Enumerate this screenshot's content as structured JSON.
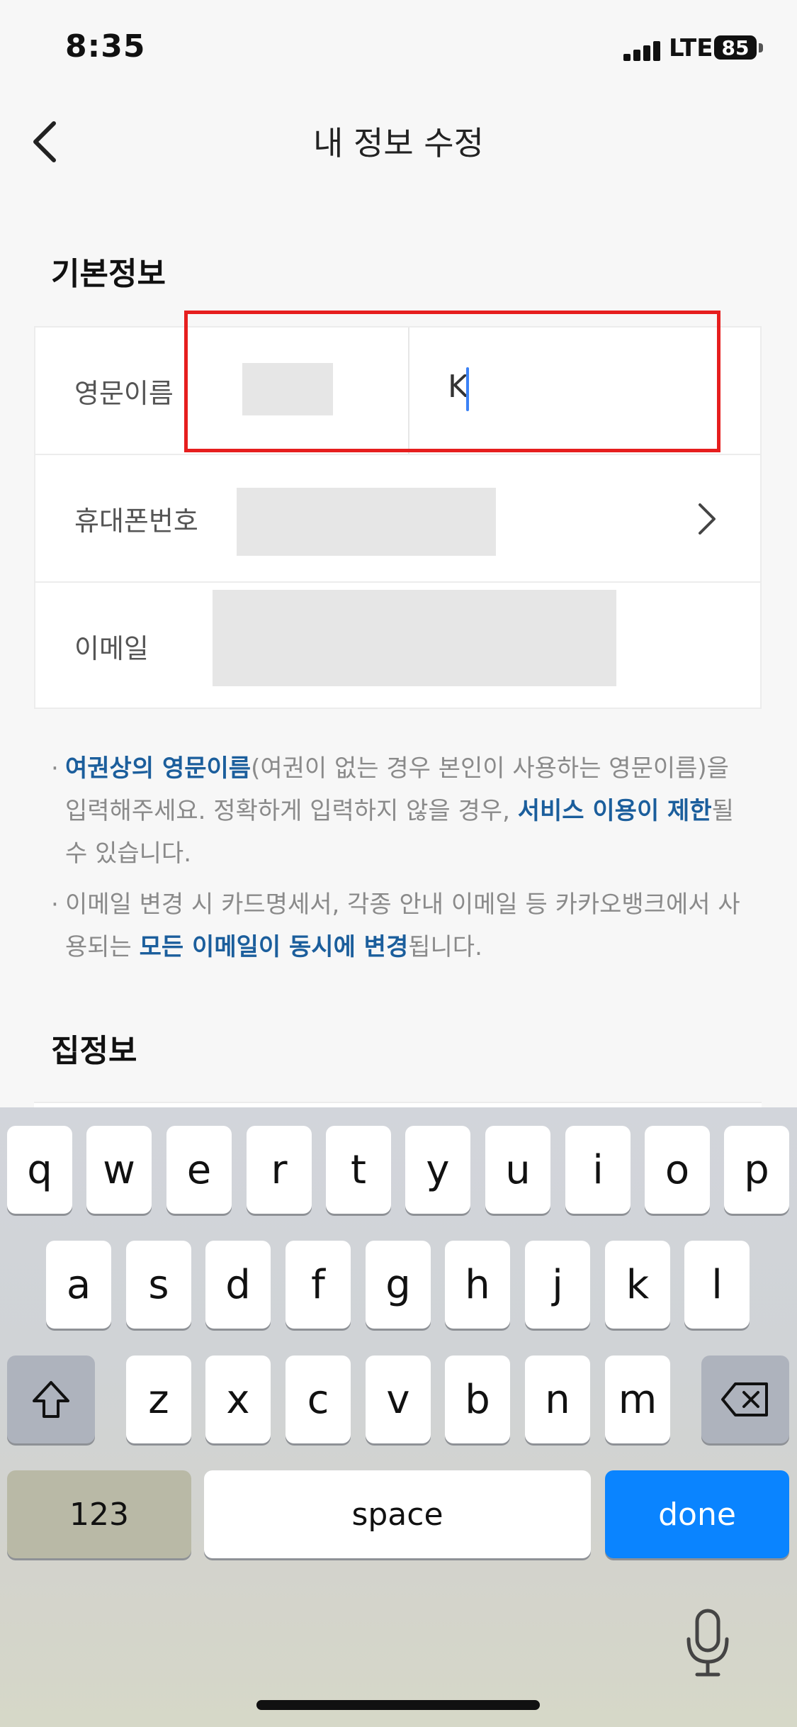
{
  "status": {
    "time": "8:35",
    "network": "LTE",
    "battery": "85"
  },
  "header": {
    "title": "내 정보 수정"
  },
  "basic": {
    "title": "기본정보",
    "rows": [
      {
        "label": "영문이름",
        "value": "K"
      },
      {
        "label": "휴대폰번호"
      },
      {
        "label": "이메일"
      }
    ]
  },
  "notes": [
    {
      "pre": "",
      "hl1": "여권상의 영문이름",
      "mid": "(여권이 없는 경우 본인이 사용하는 영문이름)을 입력해주세요. 정확하게 입력하지 않을 경우, ",
      "hl2": "서비스 이용이 제한",
      "post": "될 수 있습니다."
    },
    {
      "pre": "이메일 변경 시 카드명세서, 각종 안내 이메일 등 카카오뱅크에서 사용되는 ",
      "hl1": "모든 이메일이 동시에 변경",
      "mid": "됩니다.",
      "hl2": "",
      "post": ""
    }
  ],
  "home": {
    "title": "집정보"
  },
  "keyboard": {
    "row1": [
      "q",
      "w",
      "e",
      "r",
      "t",
      "y",
      "u",
      "i",
      "o",
      "p"
    ],
    "row2": [
      "a",
      "s",
      "d",
      "f",
      "g",
      "h",
      "j",
      "k",
      "l"
    ],
    "row3": [
      "z",
      "x",
      "c",
      "v",
      "b",
      "n",
      "m"
    ],
    "numbers": "123",
    "space": "space",
    "done": "done"
  }
}
